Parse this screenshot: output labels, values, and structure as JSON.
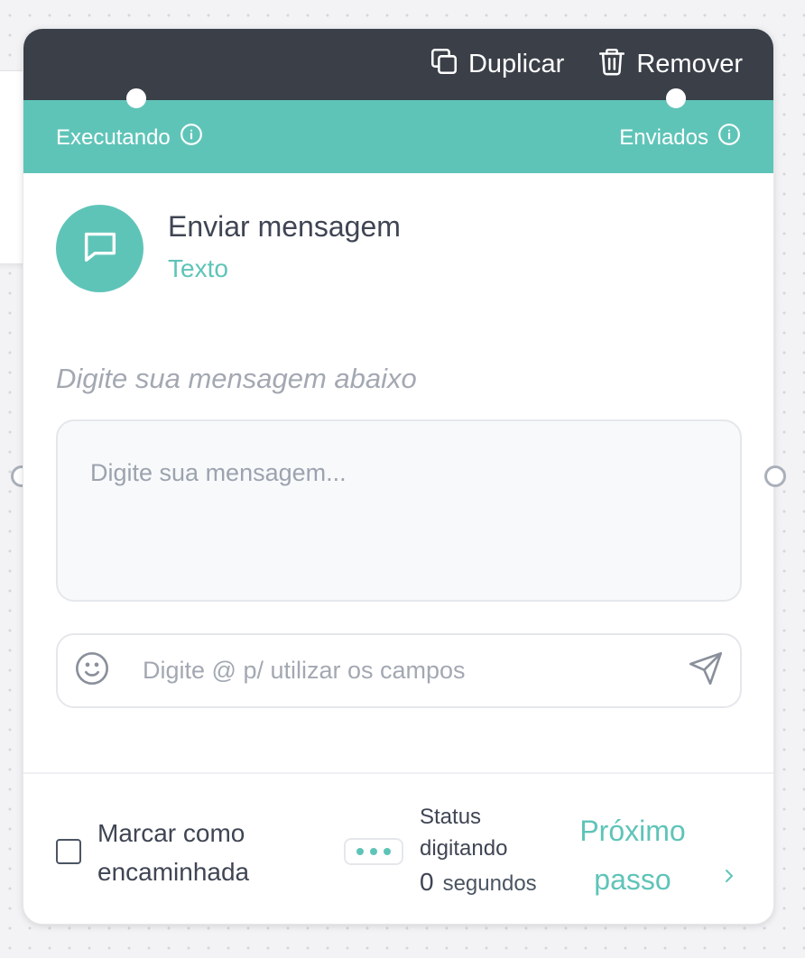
{
  "toolbar": {
    "duplicate_label": "Duplicar",
    "remove_label": "Remover"
  },
  "status_strip": {
    "left_label": "Executando",
    "right_label": "Enviados"
  },
  "node": {
    "title": "Enviar mensagem",
    "subtitle": "Texto"
  },
  "message": {
    "hint": "Digite sua mensagem abaixo",
    "placeholder": "Digite sua mensagem..."
  },
  "field_input": {
    "placeholder": "Digite @ p/ utilizar os campos"
  },
  "footer": {
    "forward_label": "Marcar como encaminhada",
    "forward_checked": false,
    "typing_status_title": "Status digitando",
    "typing_seconds": "0",
    "typing_unit": "segundos",
    "next_step_label": "Próximo passo"
  },
  "colors": {
    "accent": "#5fc4b8",
    "toolbar": "#3a3f48"
  },
  "icons": {
    "duplicate": "copy-icon",
    "remove": "trash-icon",
    "info": "info-icon",
    "avatar": "chat-bubble-icon",
    "emoji": "smiley-icon",
    "send": "send-icon",
    "next": "chevron-right-icon"
  }
}
